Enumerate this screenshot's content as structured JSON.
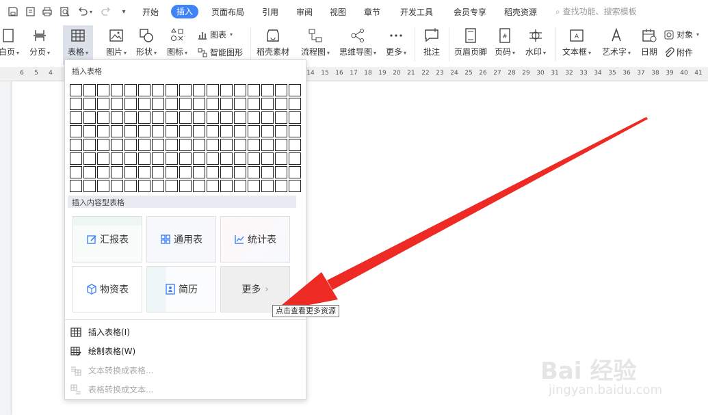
{
  "menubar": {
    "tabs": [
      "开始",
      "插入",
      "页面布局",
      "引用",
      "审阅",
      "视图",
      "章节",
      "开发工具",
      "会员专享",
      "稻壳资源"
    ],
    "active_tab": "插入",
    "search_placeholder": "查找功能、搜索模板"
  },
  "ribbon": {
    "page_label": "白页",
    "break_label": "分页",
    "table_label": "表格",
    "picture_label": "图片",
    "shape_label": "形状",
    "icon_label": "图标",
    "chart_label": "图表",
    "smartart_label": "智能图形",
    "docer_label": "稻壳素材",
    "flowchart_label": "流程图",
    "mindmap_label": "思维导图",
    "more_label": "更多",
    "comment_label": "批注",
    "headerfooter_label": "页眉页脚",
    "pagenum_label": "页码",
    "watermark_label": "水印",
    "textbox_label": "文本框",
    "wordart_label": "艺术字",
    "date_label": "日期",
    "object_label": "对象",
    "attachment_label": "附件"
  },
  "ruler": {
    "left_numbers": [
      "6",
      "5",
      "4"
    ],
    "right_numbers": [
      "14",
      "15",
      "16",
      "17",
      "18",
      "19",
      "20",
      "21",
      "22",
      "23",
      "24",
      "25",
      "26",
      "27",
      "28",
      "29",
      "30",
      "31",
      "32",
      "33",
      "34",
      "35",
      "36",
      "37",
      "38",
      "39",
      "40",
      "41"
    ]
  },
  "panel": {
    "insert_table_title": "插入表格",
    "content_table_title": "插入内容型表格",
    "cards": {
      "report": "汇报表",
      "general": "通用表",
      "stats": "统计表",
      "supply": "物资表",
      "resume": "简历",
      "more": "更多"
    },
    "menu": {
      "insert_table": "插入表格(I)",
      "draw_table": "绘制表格(W)",
      "text_to_table": "文本转换成表格...",
      "table_to_text": "表格转换成文本..."
    }
  },
  "tooltip": "点击查看更多资源",
  "watermark": {
    "brand": "Bai 经验",
    "url": "jingyan.baidu.com"
  },
  "colors": {
    "accent": "#3e83f8",
    "arrow": "#ee2a24"
  }
}
